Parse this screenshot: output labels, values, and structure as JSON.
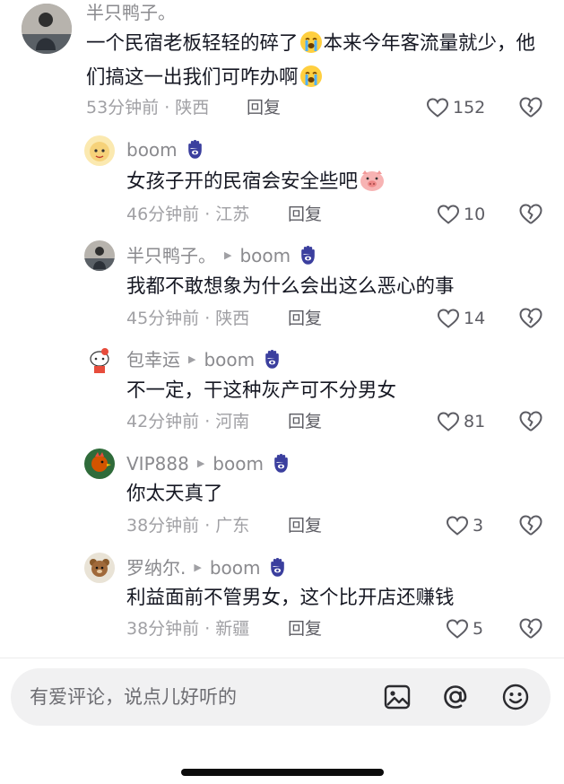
{
  "comments": [
    {
      "username": "半只鸭子。",
      "text_part1": "一个民宿老板轻轻的碎了",
      "text_part2": "本来今年客流量就少，他们搞这一出我们可咋办啊",
      "time_location": "53分钟前 · 陕西",
      "reply_label": "回复",
      "like_count": "152"
    }
  ],
  "replies": [
    {
      "username": "boom",
      "text": "女孩子开的民宿会安全些吧",
      "time_location": "46分钟前 · 江苏",
      "reply_label": "回复",
      "like_count": "10"
    },
    {
      "username": "半只鸭子。",
      "reply_to": "boom",
      "text": "我都不敢想象为什么会出这么恶心的事",
      "time_location": "45分钟前 · 陕西",
      "reply_label": "回复",
      "like_count": "14"
    },
    {
      "username": "包幸运",
      "reply_to": "boom",
      "text": "不一定，干这种灰产可不分男女",
      "time_location": "42分钟前 · 河南",
      "reply_label": "回复",
      "like_count": "81"
    },
    {
      "username": "VIP888",
      "reply_to": "boom",
      "text": "你太天真了",
      "time_location": "38分钟前 · 广东",
      "reply_label": "回复",
      "like_count": "3"
    },
    {
      "username": "罗纳尔.",
      "reply_to": "boom",
      "text": "利益面前不管男女，这个比开店还赚钱",
      "time_location": "38分钟前 · 新疆",
      "reply_label": "回复",
      "like_count": "5"
    }
  ],
  "input": {
    "placeholder": "有爱评论，说点儿好听的"
  },
  "icons": {
    "like": "heart-outline-icon",
    "dislike": "broken-heart-icon",
    "badge": "hamsa-hand-icon",
    "image": "image-icon",
    "mention": "at-sign-icon",
    "emoji": "smiley-icon"
  },
  "colors": {
    "badge": "#3b3f9e",
    "muted_text": "#a0a0a4",
    "input_bg": "#f1f1f2"
  }
}
